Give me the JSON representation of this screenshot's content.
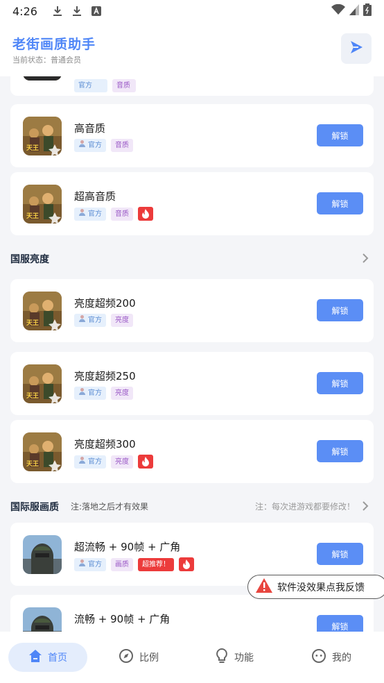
{
  "status_bar": {
    "time": "4:26",
    "icons_left": [
      "download-icon",
      "download-icon",
      "text-a-icon"
    ],
    "icons_right": [
      "wifi-icon",
      "signal-icon",
      "battery-icon"
    ]
  },
  "header": {
    "title": "老街画质助手",
    "subtitle": "当前状态：普通会员",
    "play_icon": "play-icon"
  },
  "partial_card_top": {
    "tags": [
      "官方",
      "音质"
    ]
  },
  "group1_cards": [
    {
      "name": "高音质",
      "official": "官方",
      "category": "音质",
      "hot": false,
      "unlock": "解锁"
    },
    {
      "name": "超高音质",
      "official": "官方",
      "category": "音质",
      "hot": true,
      "unlock": "解锁"
    }
  ],
  "section_cn_brightness": {
    "title": "国服亮度"
  },
  "group2_cards": [
    {
      "name": "亮度超频200",
      "official": "官方",
      "category": "亮度",
      "hot": false,
      "unlock": "解锁"
    },
    {
      "name": "亮度超频250",
      "official": "官方",
      "category": "亮度",
      "hot": false,
      "unlock": "解锁"
    },
    {
      "name": "亮度超频300",
      "official": "官方",
      "category": "亮度",
      "hot": true,
      "unlock": "解锁"
    }
  ],
  "section_intl": {
    "title": "国际服画质",
    "note": "注:落地之后才有效果",
    "right_note": "注：每次进游戏都要修改！"
  },
  "group3_cards": [
    {
      "name": "超流畅 + 90帧 + 广角",
      "official": "官方",
      "category": "画质",
      "recommend": "超推荐！",
      "hot": true,
      "unlock": "解锁"
    },
    {
      "name": "流畅 + 90帧 + 广角",
      "unlock": "解锁"
    }
  ],
  "feedback": {
    "label": "软件没效果点我反馈",
    "icon": "warning-icon"
  },
  "bottom_nav": [
    {
      "label": "首页",
      "icon": "home-icon",
      "active": true
    },
    {
      "label": "比例",
      "icon": "compass-icon",
      "active": false
    },
    {
      "label": "功能",
      "icon": "bulb-icon",
      "active": false
    },
    {
      "label": "我的",
      "icon": "face-icon",
      "active": false
    }
  ],
  "colors": {
    "accent": "#4f86f7",
    "unlock_button": "#5b8ef5",
    "hot": "#ec3b3b",
    "official_tag_bg": "#e6f0fc",
    "category_tag_bg": "#f1e7f8"
  }
}
